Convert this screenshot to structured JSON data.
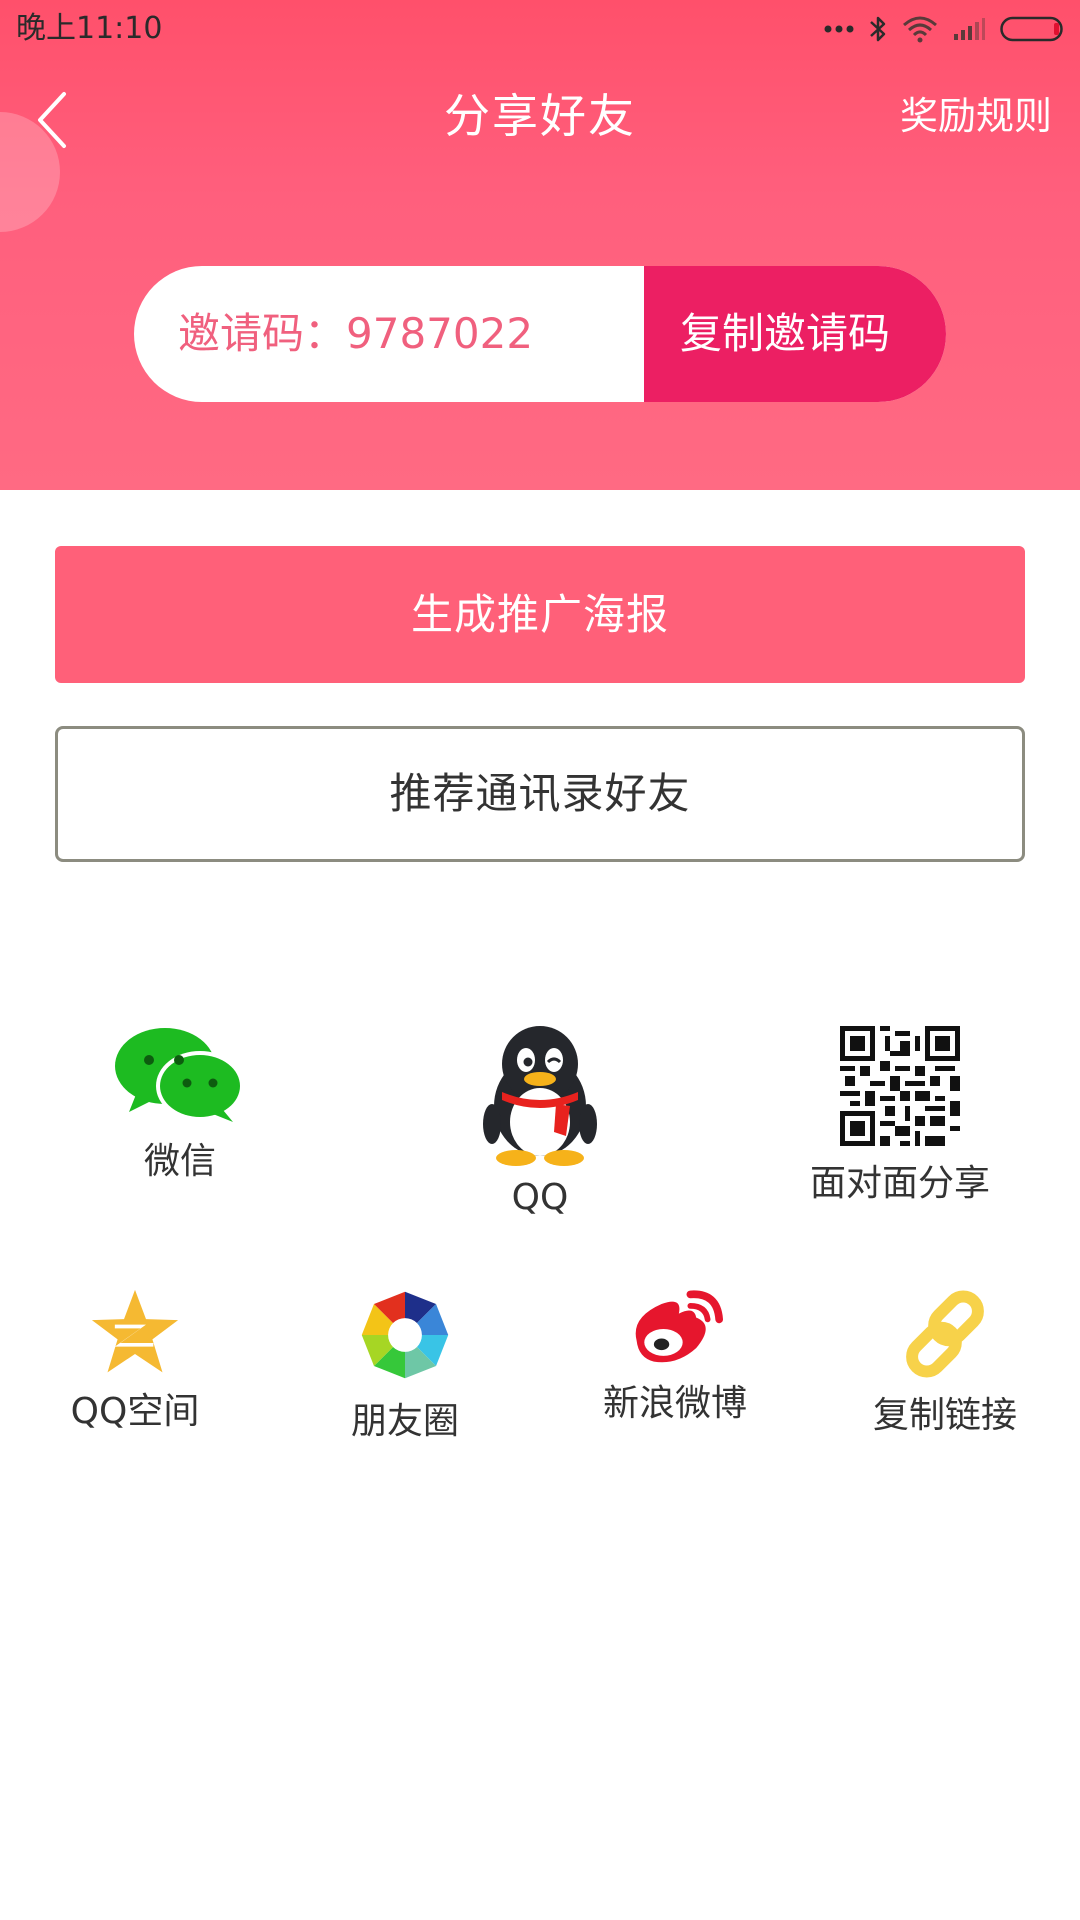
{
  "status_bar": {
    "time": "晚上11:10"
  },
  "header": {
    "title": "分享好友",
    "rules_link": "奖励规则"
  },
  "invite": {
    "code_label": "邀请码：9787022",
    "copy_button": "复制邀请码"
  },
  "actions": {
    "poster_button": "生成推广海报",
    "contacts_button": "推荐通讯录好友"
  },
  "share": {
    "row1": [
      {
        "label": "微信",
        "icon": "wechat-icon"
      },
      {
        "label": "QQ",
        "icon": "qq-icon"
      },
      {
        "label": "面对面分享",
        "icon": "qrcode-icon"
      }
    ],
    "row2": [
      {
        "label": "QQ空间",
        "icon": "qzone-icon"
      },
      {
        "label": "朋友圈",
        "icon": "moments-icon"
      },
      {
        "label": "新浪微博",
        "icon": "weibo-icon"
      },
      {
        "label": "复制链接",
        "icon": "link-icon"
      }
    ]
  },
  "colors": {
    "primary": "#ff6079",
    "accent": "#ec1f63",
    "invite_text": "#f0607e"
  }
}
